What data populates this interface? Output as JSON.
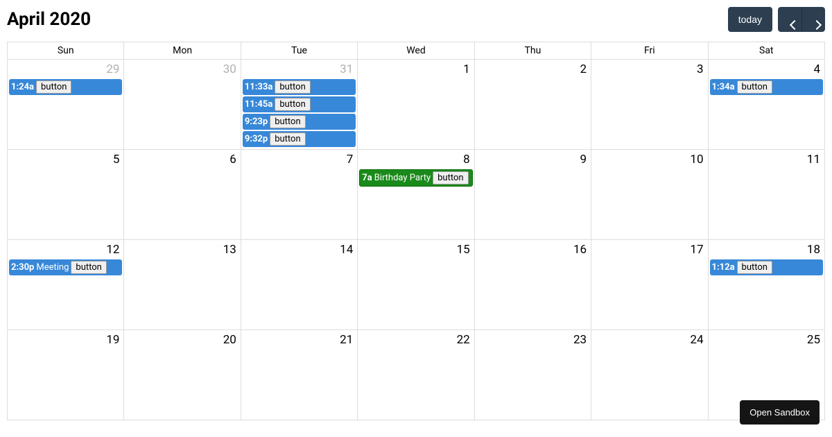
{
  "header": {
    "title": "April 2020",
    "today_label": "today"
  },
  "day_headers": [
    "Sun",
    "Mon",
    "Tue",
    "Wed",
    "Thu",
    "Fri",
    "Sat"
  ],
  "event_button_label": "button",
  "weeks": [
    {
      "days": [
        {
          "num": "29",
          "other": true,
          "events": [
            {
              "time": "1:24a",
              "title": "",
              "color": "blue"
            }
          ]
        },
        {
          "num": "30",
          "other": true,
          "events": []
        },
        {
          "num": "31",
          "other": true,
          "events": [
            {
              "time": "11:33a",
              "title": "",
              "color": "blue"
            },
            {
              "time": "11:45a",
              "title": "",
              "color": "blue"
            },
            {
              "time": "9:23p",
              "title": "",
              "color": "blue"
            },
            {
              "time": "9:32p",
              "title": "",
              "color": "blue"
            }
          ]
        },
        {
          "num": "1",
          "other": false,
          "events": []
        },
        {
          "num": "2",
          "other": false,
          "events": []
        },
        {
          "num": "3",
          "other": false,
          "events": []
        },
        {
          "num": "4",
          "other": false,
          "events": [
            {
              "time": "1:34a",
              "title": "",
              "color": "blue"
            }
          ]
        }
      ]
    },
    {
      "days": [
        {
          "num": "5",
          "other": false,
          "events": []
        },
        {
          "num": "6",
          "other": false,
          "events": []
        },
        {
          "num": "7",
          "other": false,
          "events": []
        },
        {
          "num": "8",
          "other": false,
          "events": [
            {
              "time": "7a",
              "title": "Birthday Party",
              "color": "green"
            }
          ]
        },
        {
          "num": "9",
          "other": false,
          "events": []
        },
        {
          "num": "10",
          "other": false,
          "events": []
        },
        {
          "num": "11",
          "other": false,
          "events": []
        }
      ]
    },
    {
      "days": [
        {
          "num": "12",
          "other": false,
          "events": [
            {
              "time": "2:30p",
              "title": "Meeting",
              "color": "blue"
            }
          ]
        },
        {
          "num": "13",
          "other": false,
          "events": []
        },
        {
          "num": "14",
          "other": false,
          "events": []
        },
        {
          "num": "15",
          "other": false,
          "events": []
        },
        {
          "num": "16",
          "other": false,
          "events": []
        },
        {
          "num": "17",
          "other": false,
          "events": []
        },
        {
          "num": "18",
          "other": false,
          "events": [
            {
              "time": "1:12a",
              "title": "",
              "color": "blue"
            }
          ]
        }
      ]
    },
    {
      "days": [
        {
          "num": "19",
          "other": false,
          "events": []
        },
        {
          "num": "20",
          "other": false,
          "events": []
        },
        {
          "num": "21",
          "other": false,
          "events": []
        },
        {
          "num": "22",
          "other": false,
          "events": []
        },
        {
          "num": "23",
          "other": false,
          "events": []
        },
        {
          "num": "24",
          "other": false,
          "events": []
        },
        {
          "num": "25",
          "other": false,
          "events": []
        }
      ]
    }
  ],
  "footer": {
    "sandbox_label": "Open Sandbox"
  }
}
